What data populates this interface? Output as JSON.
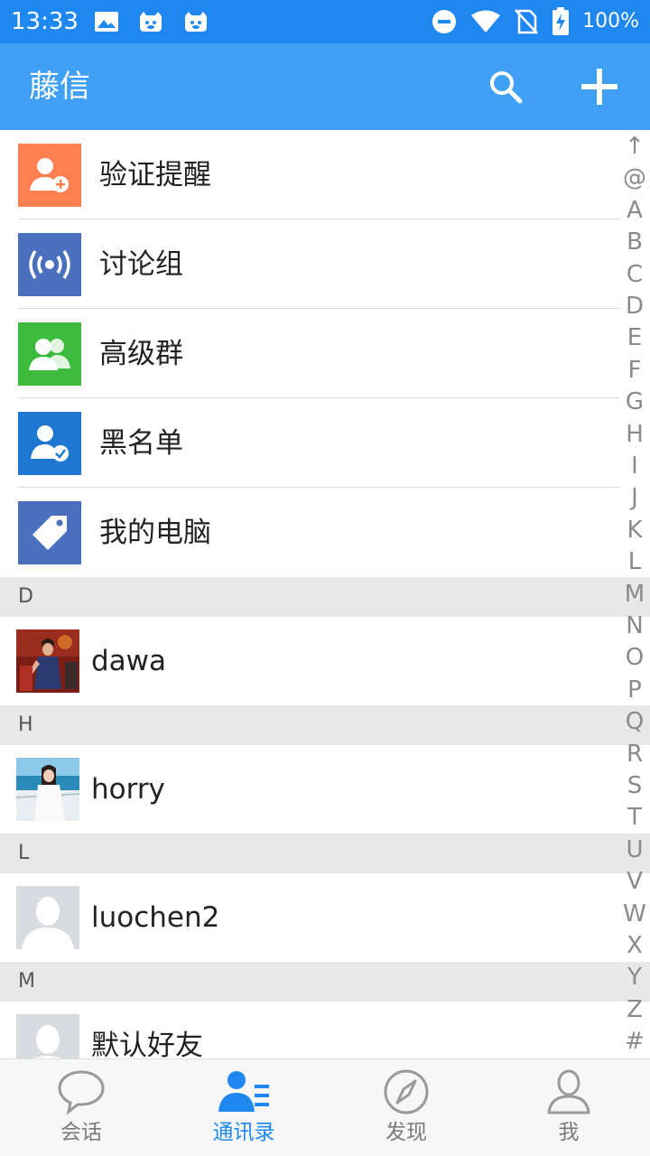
{
  "status_bar": {
    "time": "13:33",
    "battery": "100%",
    "left_icons": [
      "image-icon",
      "notification-app-icon",
      "notification-app-icon"
    ],
    "right_icons": [
      "do-not-disturb-icon",
      "wifi-icon",
      "no-sim-icon",
      "battery-charging-icon"
    ]
  },
  "app_bar": {
    "title": "藤信",
    "search_icon": "search-icon",
    "add_icon": "plus-icon"
  },
  "system_items": [
    {
      "label": "验证提醒",
      "icon": "add-contact-icon",
      "color": "#ff7f50"
    },
    {
      "label": "讨论组",
      "icon": "broadcast-icon",
      "color": "#4a6fbd"
    },
    {
      "label": "高级群",
      "icon": "group-icon",
      "color": "#3dbb3d"
    },
    {
      "label": "黑名单",
      "icon": "blocked-user-icon",
      "color": "#1e78d2"
    },
    {
      "label": "我的电脑",
      "icon": "tag-icon",
      "color": "#4a6fbd"
    }
  ],
  "sections": [
    {
      "letter": "D",
      "contacts": [
        {
          "name": "dawa"
        }
      ]
    },
    {
      "letter": "H",
      "contacts": [
        {
          "name": "horry"
        }
      ]
    },
    {
      "letter": "L",
      "contacts": [
        {
          "name": "luochen2"
        }
      ]
    },
    {
      "letter": "M",
      "contacts": [
        {
          "name": "默认好友"
        }
      ]
    }
  ],
  "index_letters": [
    "↑",
    "@",
    "A",
    "B",
    "C",
    "D",
    "E",
    "F",
    "G",
    "H",
    "I",
    "J",
    "K",
    "L",
    "M",
    "N",
    "O",
    "P",
    "Q",
    "R",
    "S",
    "T",
    "U",
    "V",
    "W",
    "X",
    "Y",
    "Z",
    "#"
  ],
  "bottom_nav": [
    {
      "label": "会话",
      "icon": "chat-bubble-icon",
      "active": false
    },
    {
      "label": "通讯录",
      "icon": "contacts-icon",
      "active": true
    },
    {
      "label": "发现",
      "icon": "compass-icon",
      "active": false
    },
    {
      "label": "我",
      "icon": "person-icon",
      "active": false
    }
  ],
  "colors": {
    "status_bar": "#1e88f0",
    "app_bar": "#40a0f5",
    "accent": "#1e88f0",
    "section_header_bg": "#e8e8e8"
  }
}
